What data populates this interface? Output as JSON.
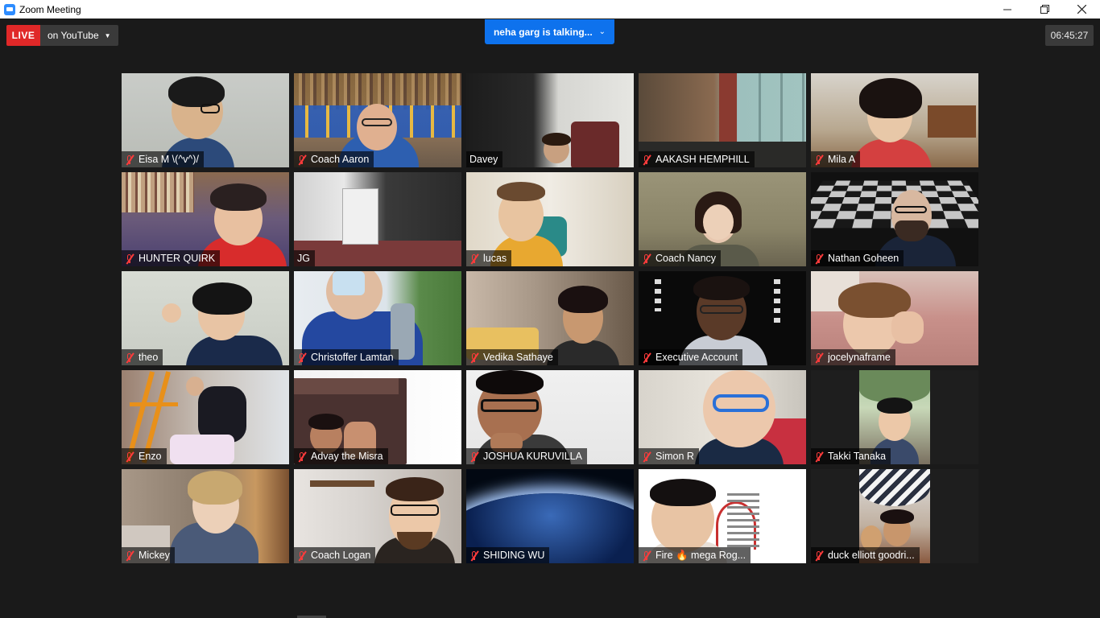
{
  "window": {
    "title": "Zoom Meeting",
    "minimize_icon": "minimize-icon",
    "restore_icon": "restore-icon",
    "close_icon": "close-icon"
  },
  "topbar": {
    "live_label": "LIVE",
    "live_destination": "on YouTube",
    "speaker_banner": "neha garg is talking...",
    "elapsed_time": "06:45:27"
  },
  "participants": [
    {
      "name": "Eisa M \\(^v^)/",
      "muted": true
    },
    {
      "name": "Coach Aaron",
      "muted": true
    },
    {
      "name": "Davey",
      "muted": false
    },
    {
      "name": "AAKASH HEMPHILL",
      "muted": true
    },
    {
      "name": "Mila A",
      "muted": true
    },
    {
      "name": "HUNTER QUIRK",
      "muted": true
    },
    {
      "name": "JG",
      "muted": false
    },
    {
      "name": "lucas",
      "muted": true
    },
    {
      "name": "Coach Nancy",
      "muted": true
    },
    {
      "name": "Nathan Goheen",
      "muted": true
    },
    {
      "name": "theo",
      "muted": true
    },
    {
      "name": "Christoffer Lamtan",
      "muted": true
    },
    {
      "name": "Vedika Sathaye",
      "muted": true
    },
    {
      "name": "Executive Account",
      "muted": true
    },
    {
      "name": "jocelynaframe",
      "muted": true
    },
    {
      "name": "Enzo",
      "muted": true
    },
    {
      "name": "Advay the Misra",
      "muted": true
    },
    {
      "name": "JOSHUA KURUVILLA",
      "muted": true
    },
    {
      "name": "Simon R",
      "muted": true
    },
    {
      "name": "Takki Tanaka",
      "muted": true
    },
    {
      "name": "Mickey",
      "muted": true
    },
    {
      "name": "Coach Logan",
      "muted": true
    },
    {
      "name": "SHIDING WU",
      "muted": true
    },
    {
      "name": "Fire 🔥 mega Rog...",
      "muted": true
    },
    {
      "name": "duck elliott goodri...",
      "muted": true
    }
  ],
  "colors": {
    "live_red": "#e02828",
    "zoom_blue": "#0e72ed",
    "mute_red": "#ff3b3b",
    "background": "#1a1a1a"
  }
}
